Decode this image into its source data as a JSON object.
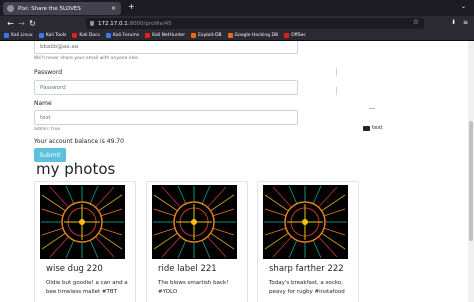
{
  "browser": {
    "tab_title": "Pixi: Share the 5LOVES",
    "tab_close": "×",
    "new_tab": "+",
    "tab_menu": "⌄",
    "back": "←",
    "forward": "→",
    "reload": "↻",
    "url_host": "172.17.0.1",
    "url_rest": ":8000/profile/45",
    "bookmark_star": "☆",
    "nav_icons": [
      "⬇",
      "≡"
    ],
    "colors": {
      "chrome": "#1c1b22",
      "toolbar": "#2b2a33",
      "tab": "#42414d"
    }
  },
  "bookmarks": [
    {
      "label": "Kali Linux",
      "icon_color": "#367bf0"
    },
    {
      "label": "Kali Tools",
      "icon_color": "#367bf0"
    },
    {
      "label": "Kali Docs",
      "icon_color": "#e02020"
    },
    {
      "label": "Kali Forums",
      "icon_color": "#367bf0"
    },
    {
      "label": "Kali NetHunter",
      "icon_color": "#e02020"
    },
    {
      "label": "Exploit-DB",
      "icon_color": "#e86a17"
    },
    {
      "label": "Google Hacking DB",
      "icon_color": "#e86a17"
    },
    {
      "label": "OffSec",
      "icon_color": "#e02020"
    }
  ],
  "form": {
    "email_value": "bbabb@aa.aa",
    "email_help": "We'll never share your email with anyone else.",
    "password_label": "Password",
    "password_placeholder": "Password",
    "name_label": "Name",
    "name_value": "test",
    "admin_note": "admin: true",
    "balance": "Your account balance is 49.70",
    "submit": "Submit"
  },
  "side": {
    "test_link": "test"
  },
  "photos": {
    "heading": "my photos",
    "items": [
      {
        "title": "wise dug 220",
        "text": "Oldie but goodie! a can and a bee timeless mallet #TBT"
      },
      {
        "title": "ride label 221",
        "text": "The blows smartish back! #YOLO"
      },
      {
        "title": "sharp farther 222",
        "text": "Today's breakfast, a socko, peavy for rugby #instafood"
      }
    ]
  },
  "colors": {
    "submit": "#5bc0de",
    "page_bg": "#ffffff"
  }
}
